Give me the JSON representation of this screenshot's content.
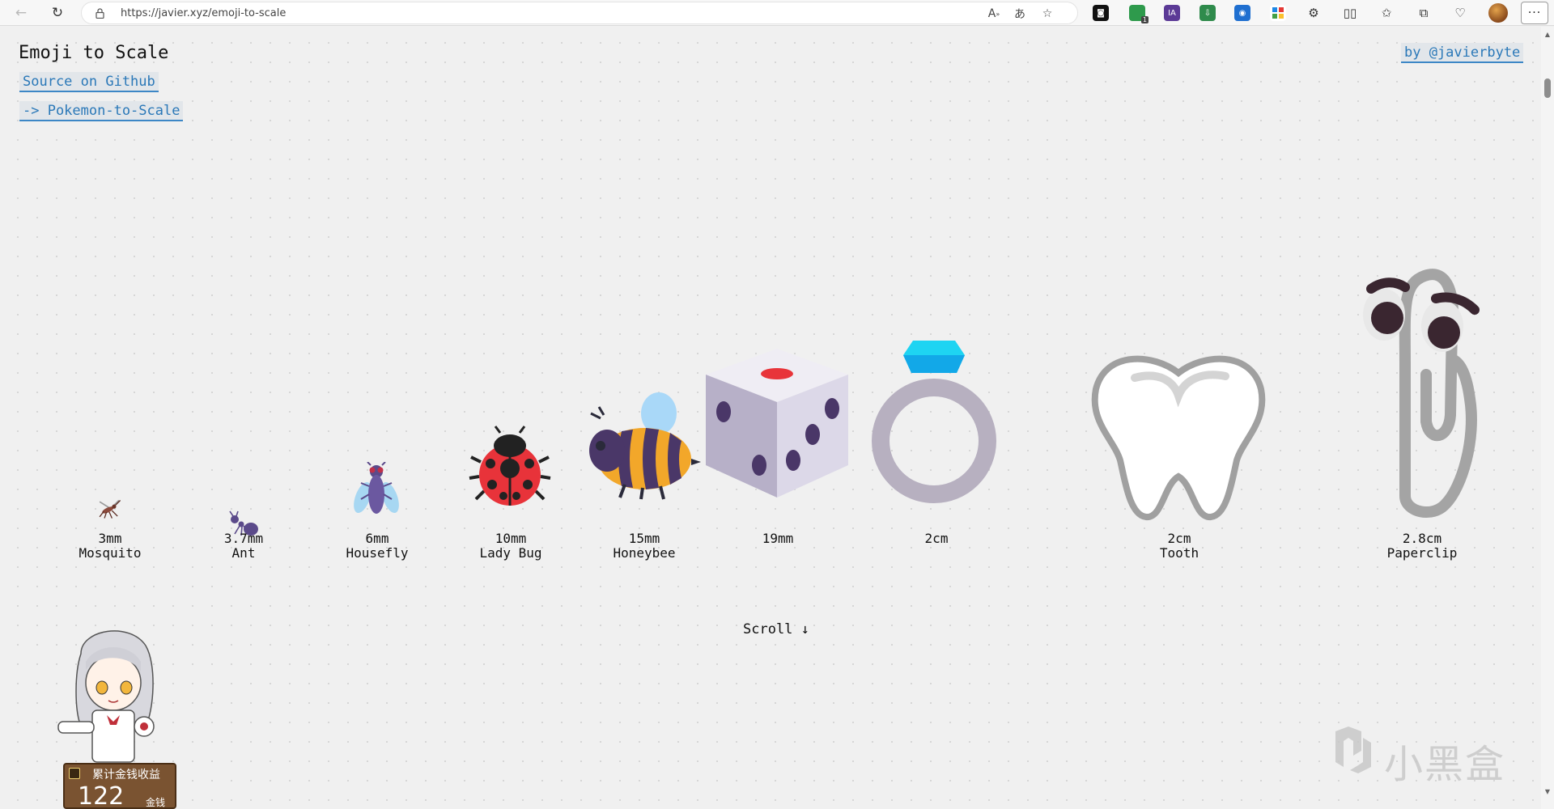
{
  "browser": {
    "url": "https://javier.xyz/emoji-to-scale",
    "extension_badge": "1",
    "extension_ia": "IA"
  },
  "page": {
    "title": "Emoji to Scale",
    "source_link": "Source on Github",
    "pokemon_link": "-> Pokemon-to-Scale",
    "author_link": "by @javierbyte",
    "scroll_hint": "Scroll ↓"
  },
  "items": [
    {
      "size": "3mm",
      "name": "Mosquito",
      "icon": "mosquito-emoji"
    },
    {
      "size": "3.7mm",
      "name": "Ant",
      "icon": "ant-emoji"
    },
    {
      "size": "6mm",
      "name": "Housefly",
      "icon": "housefly-emoji"
    },
    {
      "size": "10mm",
      "name": "Lady Bug",
      "icon": "lady-beetle-emoji"
    },
    {
      "size": "15mm",
      "name": "Honeybee",
      "icon": "honeybee-emoji"
    },
    {
      "size": "19mm",
      "name": "",
      "icon": "game-die-emoji"
    },
    {
      "size": "2cm",
      "name": "",
      "icon": "ring-emoji"
    },
    {
      "size": "2cm",
      "name": "Tooth",
      "icon": "tooth-emoji"
    },
    {
      "size": "2.8cm",
      "name": "Paperclip",
      "icon": "paperclip-emoji"
    }
  ],
  "overlay": {
    "coin_title": "累计金钱收益",
    "coin_value": "122",
    "coin_unit": "金钱",
    "watermark": "小黑盒"
  },
  "colors": {
    "link": "#2a78b8",
    "page_bg": "#f0f0f0"
  }
}
